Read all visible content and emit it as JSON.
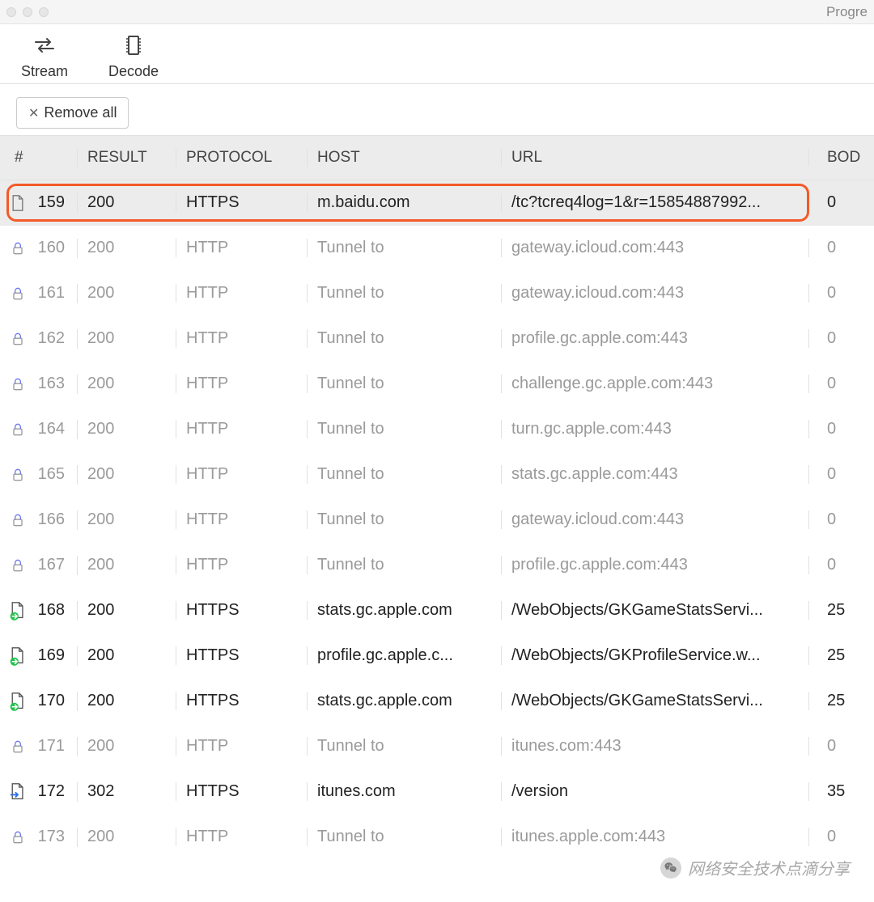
{
  "window": {
    "title_right": "Progre"
  },
  "toolbar": {
    "stream_label": "Stream",
    "decode_label": "Decode"
  },
  "actions": {
    "remove_all_label": "Remove all"
  },
  "table": {
    "headers": {
      "num": "#",
      "result": "RESULT",
      "protocol": "PROTOCOL",
      "host": "HOST",
      "url": "URL",
      "body": "BOD"
    },
    "rows": [
      {
        "icon": "file",
        "num": "159",
        "result": "200",
        "protocol": "HTTPS",
        "host": "m.baidu.com",
        "url": "/tc?tcreq4log=1&r=15854887992...",
        "body": "0",
        "bold": true,
        "selected": true,
        "highlighted": true
      },
      {
        "icon": "lock",
        "num": "160",
        "result": "200",
        "protocol": "HTTP",
        "host": "Tunnel to",
        "url": "gateway.icloud.com:443",
        "body": "0",
        "dim": true
      },
      {
        "icon": "lock",
        "num": "161",
        "result": "200",
        "protocol": "HTTP",
        "host": "Tunnel to",
        "url": "gateway.icloud.com:443",
        "body": "0",
        "dim": true
      },
      {
        "icon": "lock",
        "num": "162",
        "result": "200",
        "protocol": "HTTP",
        "host": "Tunnel to",
        "url": "profile.gc.apple.com:443",
        "body": "0",
        "dim": true
      },
      {
        "icon": "lock",
        "num": "163",
        "result": "200",
        "protocol": "HTTP",
        "host": "Tunnel to",
        "url": "challenge.gc.apple.com:443",
        "body": "0",
        "dim": true
      },
      {
        "icon": "lock",
        "num": "164",
        "result": "200",
        "protocol": "HTTP",
        "host": "Tunnel to",
        "url": "turn.gc.apple.com:443",
        "body": "0",
        "dim": true
      },
      {
        "icon": "lock",
        "num": "165",
        "result": "200",
        "protocol": "HTTP",
        "host": "Tunnel to",
        "url": "stats.gc.apple.com:443",
        "body": "0",
        "dim": true
      },
      {
        "icon": "lock",
        "num": "166",
        "result": "200",
        "protocol": "HTTP",
        "host": "Tunnel to",
        "url": "gateway.icloud.com:443",
        "body": "0",
        "dim": true
      },
      {
        "icon": "lock",
        "num": "167",
        "result": "200",
        "protocol": "HTTP",
        "host": "Tunnel to",
        "url": "profile.gc.apple.com:443",
        "body": "0",
        "dim": true
      },
      {
        "icon": "file-go",
        "num": "168",
        "result": "200",
        "protocol": "HTTPS",
        "host": "stats.gc.apple.com",
        "url": "/WebObjects/GKGameStatsServi...",
        "body": "25",
        "bold": true
      },
      {
        "icon": "file-go",
        "num": "169",
        "result": "200",
        "protocol": "HTTPS",
        "host": "profile.gc.apple.c...",
        "url": "/WebObjects/GKProfileService.w...",
        "body": "25",
        "bold": true
      },
      {
        "icon": "file-go",
        "num": "170",
        "result": "200",
        "protocol": "HTTPS",
        "host": "stats.gc.apple.com",
        "url": "/WebObjects/GKGameStatsServi...",
        "body": "25",
        "bold": true
      },
      {
        "icon": "lock",
        "num": "171",
        "result": "200",
        "protocol": "HTTP",
        "host": "Tunnel to",
        "url": "itunes.com:443",
        "body": "0",
        "dim": true
      },
      {
        "icon": "file-redirect",
        "num": "172",
        "result": "302",
        "protocol": "HTTPS",
        "host": "itunes.com",
        "url": "/version",
        "body": "35",
        "bold": true
      },
      {
        "icon": "lock",
        "num": "173",
        "result": "200",
        "protocol": "HTTP",
        "host": "Tunnel to",
        "url": "itunes.apple.com:443",
        "body": "0",
        "dim": true
      }
    ]
  },
  "watermark": {
    "text": "网络安全技术点滴分享"
  },
  "icons": {
    "file": "file-icon",
    "lock": "lock-icon",
    "file-go": "file-go-icon",
    "file-redirect": "file-redirect-icon"
  }
}
